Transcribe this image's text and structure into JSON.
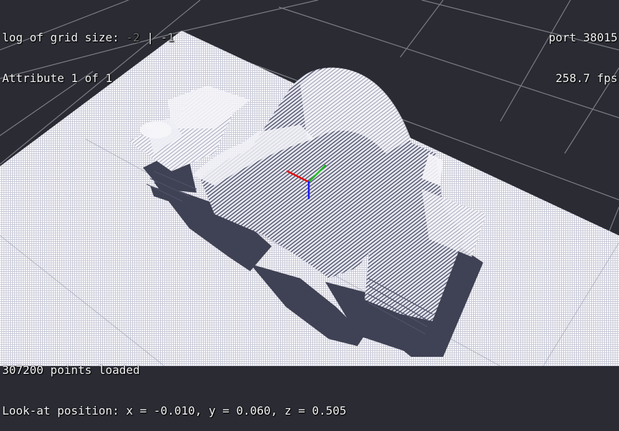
{
  "hud": {
    "grid_label": "log of grid size:",
    "grid_option_inactive": "-2",
    "grid_separator": "|",
    "grid_option_active": "-1",
    "attribute_text": "Attribute 1 of 1",
    "port_text": "port 38015",
    "fps_text": "258.7 fps",
    "points_text": "307200 points loaded",
    "lookat_text": "Look-at position: x = -0.010, y = 0.060, z = 0.505"
  },
  "colors": {
    "background": "#2a2b33",
    "grid_line": "#8a8c94",
    "floor_points": "#ffffff",
    "shadow": "#3f4154",
    "axis_x": "#e01010",
    "axis_y": "#1fc01f",
    "axis_z": "#1a1aff"
  }
}
